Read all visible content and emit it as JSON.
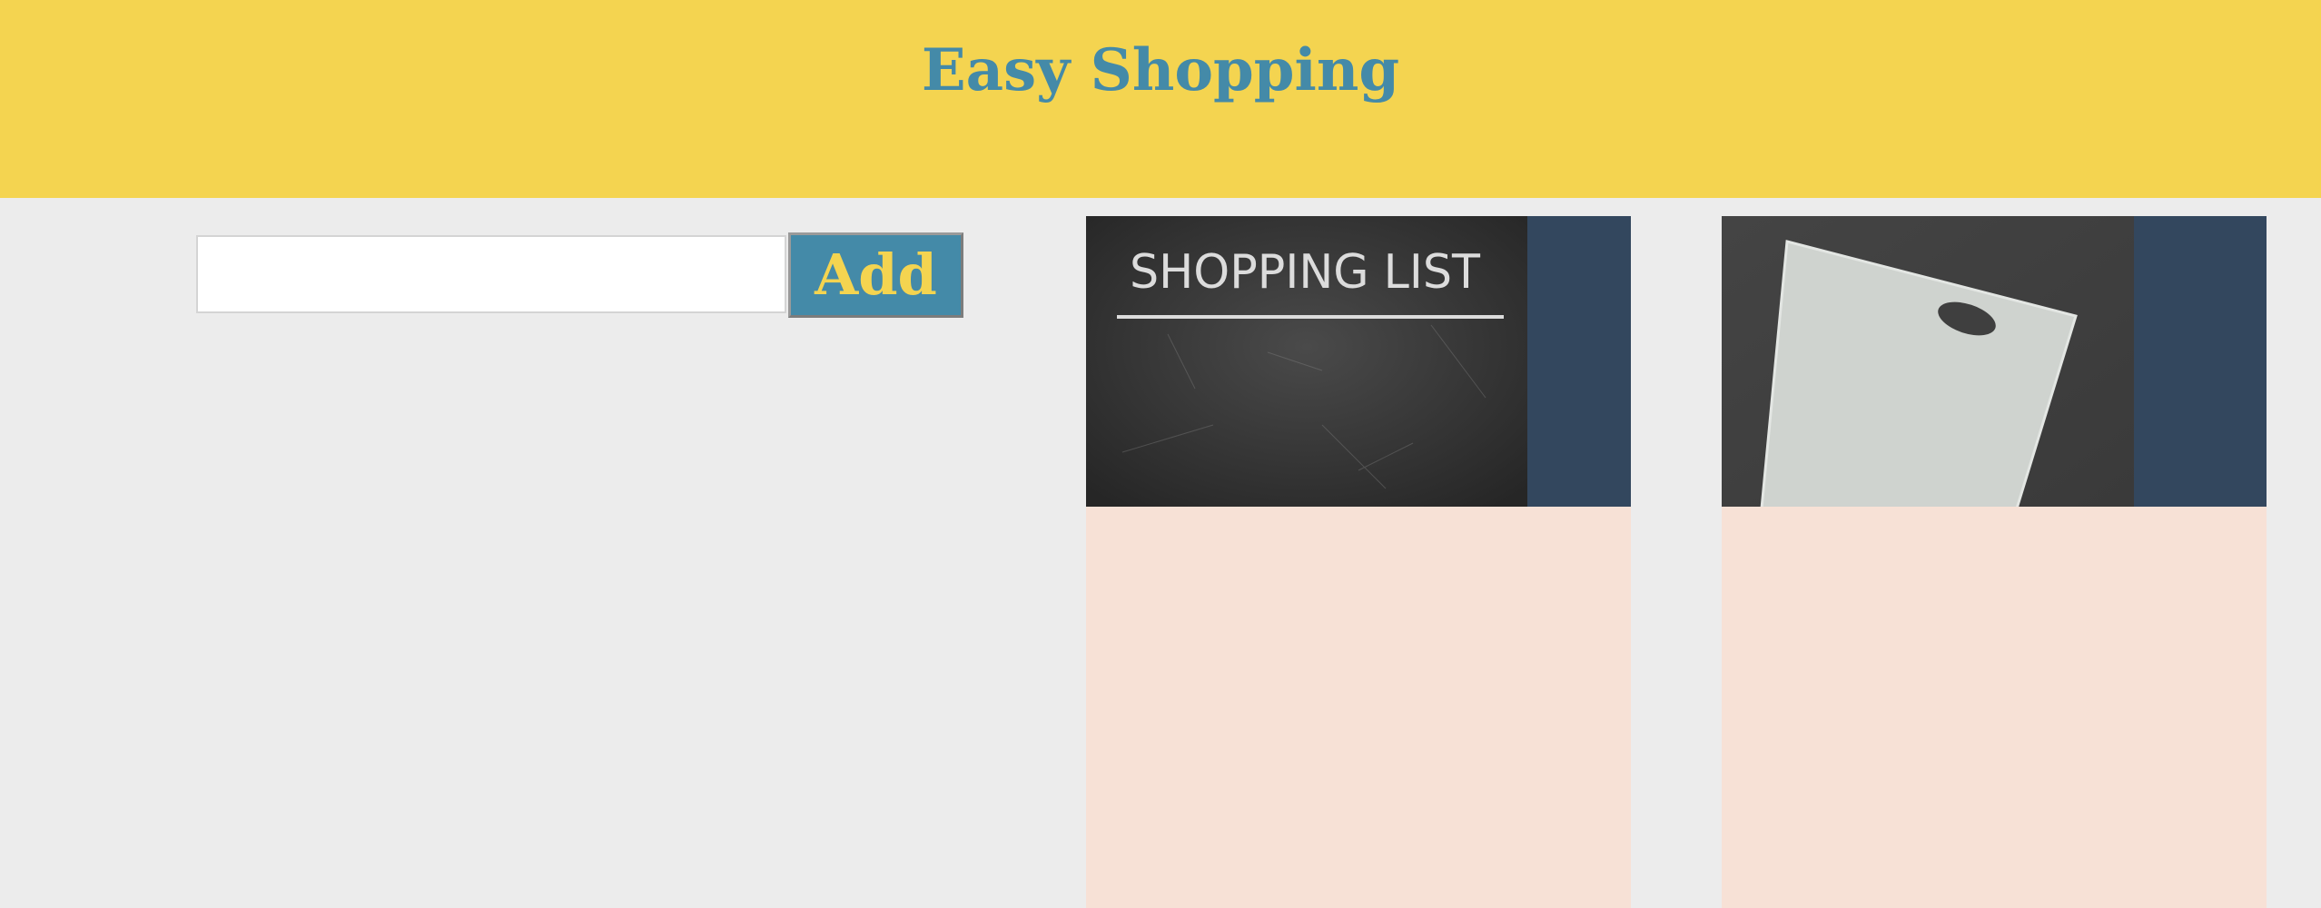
{
  "header": {
    "title": "Easy Shopping"
  },
  "form": {
    "input_value": "",
    "input_placeholder": "",
    "add_label": "Add"
  },
  "cards": [
    {
      "image_text": "SHOPPING LIST",
      "image_icon": "chalkboard-image"
    },
    {
      "image_text": "",
      "image_icon": "shopping-bag-image"
    }
  ],
  "colors": {
    "header_bg": "#f4d450",
    "title": "#448aa8",
    "page_bg": "#ececec",
    "button_bg": "#448aa8",
    "button_text": "#f4d450",
    "card_bg": "#f7e1d6",
    "card_image_bg": "#33475e"
  }
}
